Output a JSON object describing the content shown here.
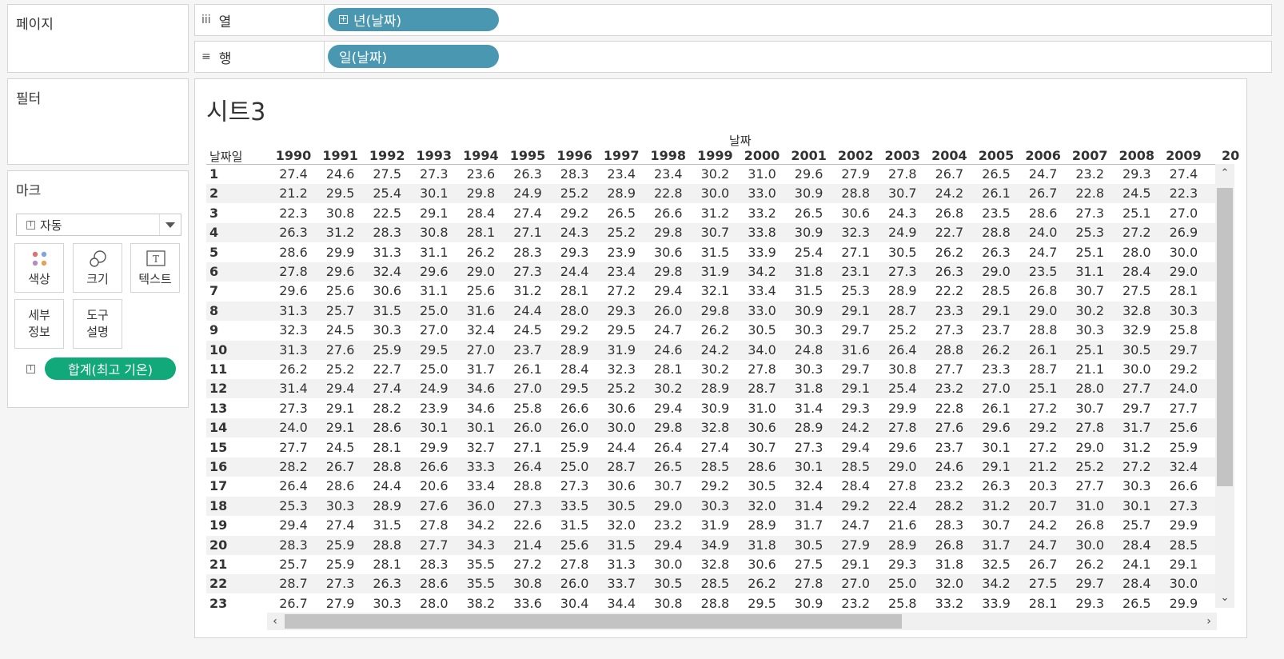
{
  "panels": {
    "pages": "페이지",
    "filters": "필터",
    "marks": "마크"
  },
  "shelves": {
    "columns": {
      "label": "열",
      "icon": "iii",
      "pill": "년(날짜)"
    },
    "rows": {
      "label": "행",
      "icon": "≡",
      "pill": "일(날짜)"
    }
  },
  "marks": {
    "type": "자동",
    "buttons": {
      "color": "색상",
      "size": "크기",
      "text": "텍스트",
      "detail": "세부\n정보",
      "tooltip": "도구\n설명"
    },
    "field_pill": "합계(최고 기온)"
  },
  "sheet": {
    "title": "시트3",
    "column_group_label": "날짜",
    "row_header_label": "날짜일",
    "years": [
      "1990",
      "1991",
      "1992",
      "1993",
      "1994",
      "1995",
      "1996",
      "1997",
      "1998",
      "1999",
      "2000",
      "2001",
      "2002",
      "2003",
      "2004",
      "2005",
      "2006",
      "2007",
      "2008",
      "2009",
      "20"
    ],
    "rows": [
      {
        "day": "1",
        "values": [
          "27.4",
          "24.6",
          "27.5",
          "27.3",
          "23.6",
          "26.3",
          "28.3",
          "23.4",
          "23.4",
          "30.2",
          "31.0",
          "29.6",
          "27.9",
          "27.8",
          "26.7",
          "26.5",
          "24.7",
          "23.2",
          "29.3",
          "27.4"
        ]
      },
      {
        "day": "2",
        "values": [
          "21.2",
          "29.5",
          "25.4",
          "30.1",
          "29.8",
          "24.9",
          "25.2",
          "28.9",
          "22.8",
          "30.0",
          "33.0",
          "30.9",
          "28.8",
          "30.7",
          "24.2",
          "26.1",
          "26.7",
          "22.8",
          "24.5",
          "22.3"
        ]
      },
      {
        "day": "3",
        "values": [
          "22.3",
          "30.8",
          "22.5",
          "29.1",
          "28.4",
          "27.4",
          "29.2",
          "26.5",
          "26.6",
          "31.2",
          "33.2",
          "26.5",
          "30.6",
          "24.3",
          "26.8",
          "23.5",
          "28.6",
          "27.3",
          "25.1",
          "27.0"
        ]
      },
      {
        "day": "4",
        "values": [
          "26.3",
          "31.2",
          "28.3",
          "30.8",
          "28.1",
          "27.1",
          "24.3",
          "25.2",
          "29.8",
          "30.7",
          "33.8",
          "30.9",
          "32.3",
          "24.9",
          "22.7",
          "28.8",
          "24.0",
          "25.3",
          "27.2",
          "26.9"
        ]
      },
      {
        "day": "5",
        "values": [
          "28.6",
          "29.9",
          "31.3",
          "31.1",
          "26.2",
          "28.3",
          "29.3",
          "23.9",
          "30.6",
          "31.5",
          "33.9",
          "25.4",
          "27.1",
          "30.5",
          "26.2",
          "26.3",
          "24.7",
          "25.1",
          "28.0",
          "30.0"
        ]
      },
      {
        "day": "6",
        "values": [
          "27.8",
          "29.6",
          "32.4",
          "29.6",
          "29.0",
          "27.3",
          "24.4",
          "23.4",
          "29.8",
          "31.9",
          "34.2",
          "31.8",
          "23.1",
          "27.3",
          "26.3",
          "29.0",
          "23.5",
          "31.1",
          "28.4",
          "29.0"
        ]
      },
      {
        "day": "7",
        "values": [
          "29.6",
          "25.6",
          "30.6",
          "31.1",
          "25.6",
          "31.2",
          "28.1",
          "27.2",
          "29.4",
          "32.1",
          "33.4",
          "31.5",
          "25.3",
          "28.9",
          "22.2",
          "28.5",
          "26.8",
          "30.7",
          "27.5",
          "28.1"
        ]
      },
      {
        "day": "8",
        "values": [
          "31.3",
          "25.7",
          "31.5",
          "25.0",
          "31.6",
          "24.4",
          "28.0",
          "29.3",
          "26.0",
          "29.8",
          "33.0",
          "30.9",
          "29.1",
          "28.7",
          "23.3",
          "29.1",
          "29.0",
          "30.2",
          "32.8",
          "30.3"
        ]
      },
      {
        "day": "9",
        "values": [
          "32.3",
          "24.5",
          "30.3",
          "27.0",
          "32.4",
          "24.5",
          "29.2",
          "29.5",
          "24.7",
          "26.2",
          "30.5",
          "30.3",
          "29.7",
          "25.2",
          "27.3",
          "23.7",
          "28.8",
          "30.3",
          "32.9",
          "25.8"
        ]
      },
      {
        "day": "10",
        "values": [
          "31.3",
          "27.6",
          "25.9",
          "29.5",
          "27.0",
          "23.7",
          "28.9",
          "31.9",
          "24.6",
          "24.2",
          "34.0",
          "24.8",
          "31.6",
          "26.4",
          "28.8",
          "26.2",
          "26.1",
          "25.1",
          "30.5",
          "29.7"
        ]
      },
      {
        "day": "11",
        "values": [
          "26.2",
          "25.2",
          "22.7",
          "25.0",
          "31.7",
          "26.1",
          "28.4",
          "32.3",
          "28.1",
          "30.2",
          "27.8",
          "30.3",
          "29.7",
          "30.8",
          "27.7",
          "23.3",
          "28.7",
          "21.1",
          "30.0",
          "29.2"
        ]
      },
      {
        "day": "12",
        "values": [
          "31.4",
          "29.4",
          "27.4",
          "24.9",
          "34.6",
          "27.0",
          "29.5",
          "25.2",
          "30.2",
          "28.9",
          "28.7",
          "31.8",
          "29.1",
          "25.4",
          "23.2",
          "27.0",
          "25.1",
          "28.0",
          "27.7",
          "24.0"
        ]
      },
      {
        "day": "13",
        "values": [
          "27.3",
          "29.1",
          "28.2",
          "23.9",
          "34.6",
          "25.8",
          "26.6",
          "30.6",
          "29.4",
          "30.9",
          "31.0",
          "31.4",
          "29.3",
          "29.9",
          "22.8",
          "26.1",
          "27.2",
          "30.7",
          "29.7",
          "27.7"
        ]
      },
      {
        "day": "14",
        "values": [
          "24.0",
          "29.1",
          "28.6",
          "30.1",
          "30.1",
          "26.0",
          "26.0",
          "30.0",
          "29.8",
          "32.8",
          "30.6",
          "28.9",
          "24.2",
          "27.8",
          "27.6",
          "29.6",
          "29.2",
          "27.8",
          "31.7",
          "25.6"
        ]
      },
      {
        "day": "15",
        "values": [
          "27.7",
          "24.5",
          "28.1",
          "29.9",
          "32.7",
          "27.1",
          "25.9",
          "24.4",
          "26.4",
          "27.4",
          "30.7",
          "27.3",
          "29.4",
          "29.6",
          "23.7",
          "30.1",
          "27.2",
          "29.0",
          "31.2",
          "25.9"
        ]
      },
      {
        "day": "16",
        "values": [
          "28.2",
          "26.7",
          "28.8",
          "26.6",
          "33.3",
          "26.4",
          "25.0",
          "28.7",
          "26.5",
          "28.5",
          "28.6",
          "30.1",
          "28.5",
          "29.0",
          "24.6",
          "29.1",
          "21.2",
          "25.2",
          "27.2",
          "32.4"
        ]
      },
      {
        "day": "17",
        "values": [
          "26.4",
          "28.6",
          "24.4",
          "20.6",
          "33.4",
          "28.8",
          "27.3",
          "30.6",
          "30.7",
          "29.2",
          "30.5",
          "32.4",
          "28.4",
          "27.8",
          "23.2",
          "26.3",
          "20.3",
          "27.7",
          "30.3",
          "26.6"
        ]
      },
      {
        "day": "18",
        "values": [
          "25.3",
          "30.3",
          "28.9",
          "27.6",
          "36.0",
          "27.3",
          "33.5",
          "30.5",
          "29.0",
          "30.3",
          "32.0",
          "31.4",
          "29.2",
          "22.4",
          "28.2",
          "31.2",
          "20.7",
          "31.0",
          "30.1",
          "27.3"
        ]
      },
      {
        "day": "19",
        "values": [
          "29.4",
          "27.4",
          "31.5",
          "27.8",
          "34.2",
          "22.6",
          "31.5",
          "32.0",
          "23.2",
          "31.9",
          "28.9",
          "31.7",
          "24.7",
          "21.6",
          "28.3",
          "30.7",
          "24.2",
          "26.8",
          "25.7",
          "29.9"
        ]
      },
      {
        "day": "20",
        "values": [
          "28.3",
          "25.9",
          "28.8",
          "27.7",
          "34.3",
          "21.4",
          "25.6",
          "31.5",
          "29.4",
          "34.9",
          "31.8",
          "30.5",
          "27.9",
          "28.9",
          "26.8",
          "31.7",
          "24.7",
          "30.0",
          "28.4",
          "28.5"
        ]
      },
      {
        "day": "21",
        "values": [
          "25.7",
          "25.9",
          "28.1",
          "28.3",
          "35.5",
          "27.2",
          "27.8",
          "31.3",
          "30.0",
          "32.8",
          "30.6",
          "27.5",
          "29.1",
          "29.3",
          "31.8",
          "32.5",
          "26.7",
          "26.2",
          "24.1",
          "29.1"
        ]
      },
      {
        "day": "22",
        "values": [
          "28.7",
          "27.3",
          "26.3",
          "28.6",
          "35.5",
          "30.8",
          "26.0",
          "33.7",
          "30.5",
          "28.5",
          "26.2",
          "27.8",
          "27.0",
          "25.0",
          "32.0",
          "34.2",
          "27.5",
          "29.7",
          "28.4",
          "30.0"
        ]
      },
      {
        "day": "23",
        "values": [
          "26.7",
          "27.9",
          "30.3",
          "28.0",
          "38.2",
          "33.6",
          "30.4",
          "34.4",
          "30.8",
          "28.8",
          "29.5",
          "30.9",
          "23.2",
          "25.8",
          "33.2",
          "33.9",
          "28.1",
          "29.3",
          "26.5",
          "29.9"
        ]
      }
    ]
  }
}
